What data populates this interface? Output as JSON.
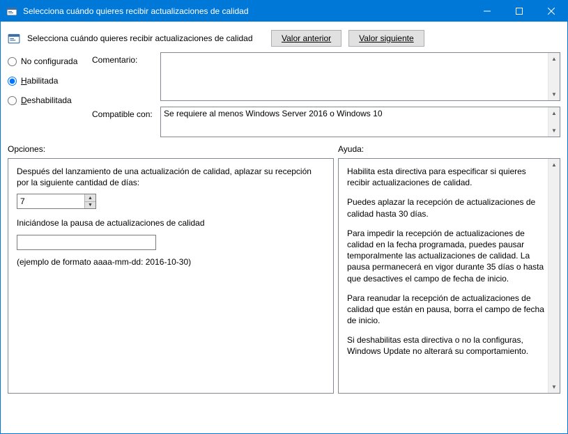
{
  "window": {
    "title": "Selecciona cuándo quieres recibir actualizaciones de calidad"
  },
  "header": {
    "title": "Selecciona cuándo quieres recibir actualizaciones de calidad",
    "prev_button": "Valor anterior",
    "next_button": "Valor siguiente"
  },
  "state_radios": {
    "not_configured": "No configurada",
    "enabled_prefix": "H",
    "enabled_rest": "abilitada",
    "disabled_prefix": "D",
    "disabled_rest": "eshabilitada",
    "selected": "enabled"
  },
  "fields": {
    "comment_label": "Comentario:",
    "comment_value": "",
    "supported_label": "Compatible con:",
    "supported_value": "Se requiere al menos Windows Server 2016 o Windows 10"
  },
  "sections": {
    "options": "Opciones:",
    "help": "Ayuda:"
  },
  "options": {
    "defer_label": "Después del lanzamiento de una actualización de calidad, aplazar su recepción por la siguiente cantidad de días:",
    "defer_value": "7",
    "pause_label": "Iniciándose la pausa de actualizaciones de calidad",
    "pause_value": "",
    "format_hint": "(ejemplo de formato aaaa-mm-dd: 2016-10-30)"
  },
  "help": {
    "p1": "Habilita esta directiva para especificar si quieres recibir actualizaciones de calidad.",
    "p2": "Puedes aplazar la recepción de actualizaciones de calidad hasta 30 días.",
    "p3": "Para impedir la recepción de actualizaciones de calidad en la fecha programada, puedes pausar temporalmente las actualizaciones de calidad. La pausa permanecerá en vigor durante 35 días o hasta que desactives el campo de fecha de inicio.",
    "p4": "Para reanudar la recepción de actualizaciones de calidad que están en pausa, borra el campo de fecha de inicio.",
    "p5": "Si deshabilitas esta directiva o no la configuras, Windows Update no alterará su comportamiento."
  }
}
